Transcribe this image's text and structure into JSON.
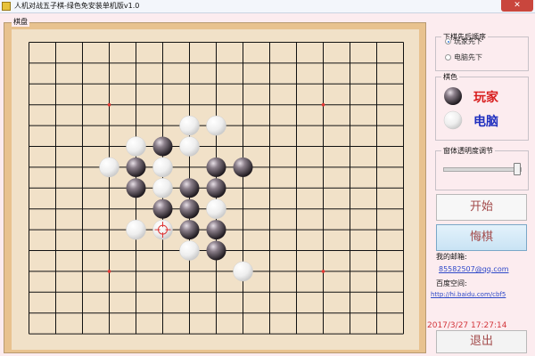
{
  "window": {
    "title": "人机对战五子棋-绿色免安装单机版v1.0",
    "close_label": "✕"
  },
  "board": {
    "label": "棋盘",
    "size": 15,
    "line_color": "#111111",
    "star_color": "#e53935",
    "star_points": [
      [
        3,
        3
      ],
      [
        3,
        11
      ],
      [
        11,
        3
      ],
      [
        11,
        11
      ]
    ],
    "cursor": {
      "row": 9,
      "col": 5
    },
    "stones": [
      {
        "row": 4,
        "col": 6,
        "color": "white"
      },
      {
        "row": 4,
        "col": 7,
        "color": "white"
      },
      {
        "row": 5,
        "col": 4,
        "color": "white"
      },
      {
        "row": 5,
        "col": 5,
        "color": "black"
      },
      {
        "row": 5,
        "col": 6,
        "color": "white"
      },
      {
        "row": 6,
        "col": 3,
        "color": "white"
      },
      {
        "row": 6,
        "col": 4,
        "color": "black"
      },
      {
        "row": 6,
        "col": 5,
        "color": "white"
      },
      {
        "row": 6,
        "col": 7,
        "color": "black"
      },
      {
        "row": 6,
        "col": 8,
        "color": "black"
      },
      {
        "row": 7,
        "col": 4,
        "color": "black"
      },
      {
        "row": 7,
        "col": 5,
        "color": "white"
      },
      {
        "row": 7,
        "col": 6,
        "color": "black"
      },
      {
        "row": 7,
        "col": 7,
        "color": "black"
      },
      {
        "row": 8,
        "col": 5,
        "color": "black"
      },
      {
        "row": 8,
        "col": 6,
        "color": "black"
      },
      {
        "row": 8,
        "col": 7,
        "color": "white"
      },
      {
        "row": 9,
        "col": 4,
        "color": "white"
      },
      {
        "row": 9,
        "col": 5,
        "color": "white"
      },
      {
        "row": 9,
        "col": 6,
        "color": "black"
      },
      {
        "row": 9,
        "col": 7,
        "color": "black"
      },
      {
        "row": 10,
        "col": 6,
        "color": "white"
      },
      {
        "row": 10,
        "col": 7,
        "color": "black"
      },
      {
        "row": 11,
        "col": 8,
        "color": "white"
      }
    ]
  },
  "order": {
    "title": "下棋先后顺序",
    "options": [
      {
        "label": "玩家先下",
        "selected": true
      },
      {
        "label": "电脑先下",
        "selected": false
      }
    ]
  },
  "colors": {
    "title": "棋色",
    "player_label": "玩家",
    "computer_label": "电脑",
    "player_label_color": "#d81e1e",
    "computer_label_color": "#1f2fbf"
  },
  "transparency": {
    "title": "窗体透明度调节",
    "value_fraction": 0.95
  },
  "buttons": {
    "start": "开始",
    "undo": "悔棋",
    "exit": "退出"
  },
  "contact": {
    "email_label": "我的邮箱:",
    "email_value": "85582507@qq.com",
    "space_label": "百度空间:",
    "space_value": "http://hi.baidu.com/cbf5"
  },
  "datetime": "2017/3/27 17:27:14"
}
